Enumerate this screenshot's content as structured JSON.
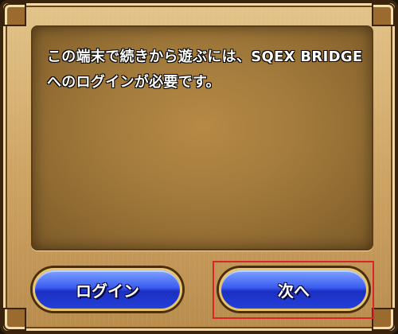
{
  "dialog": {
    "message": "この端末で続きから遊ぶには、SQEX BRIDGEへのログインが必要です。"
  },
  "buttons": {
    "login_label": "ログイン",
    "next_label": "次へ"
  },
  "colors": {
    "button_blue": "#2340d9",
    "frame_gold": "#e8c46a",
    "highlight_red": "#d9252c"
  }
}
